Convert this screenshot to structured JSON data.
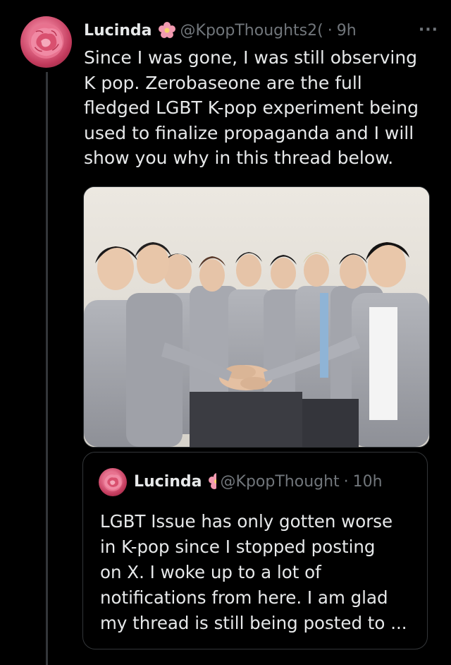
{
  "tweet": {
    "author_name": "Lucinda",
    "author_handle": "@KpopThoughts2(",
    "separator": "·",
    "time": "9h",
    "more_icon": "···",
    "text": "Since I was gone, I was still observing\nK pop. Zerobaseone are the full\nfledged LGBT K-pop experiment being\nused to finalize propaganda and I will\nshow you why in this thread below.",
    "avatar_icon": "pink-carnation-avatar",
    "badge_icon": "pink-flower-icon"
  },
  "media": {
    "kind": "photo",
    "icon": "group-photo-image"
  },
  "quoted_tweet": {
    "author_name": "Lucinda",
    "author_handle": "@KpopThought",
    "separator": "·",
    "time": "10h",
    "text": "LGBT Issue has only gotten worse\nin K-pop since I stopped posting\non X. I woke up to a lot of\nnotifications from here. I am glad\nmy thread is still being posted to ...",
    "avatar_icon": "pink-carnation-avatar",
    "badge_icon": "pink-flower-icon"
  },
  "colors": {
    "background": "#000000",
    "text_primary": "#e7e9ea",
    "text_secondary": "#71767b",
    "border": "#333639",
    "accent_pink": "#e46f8c"
  }
}
